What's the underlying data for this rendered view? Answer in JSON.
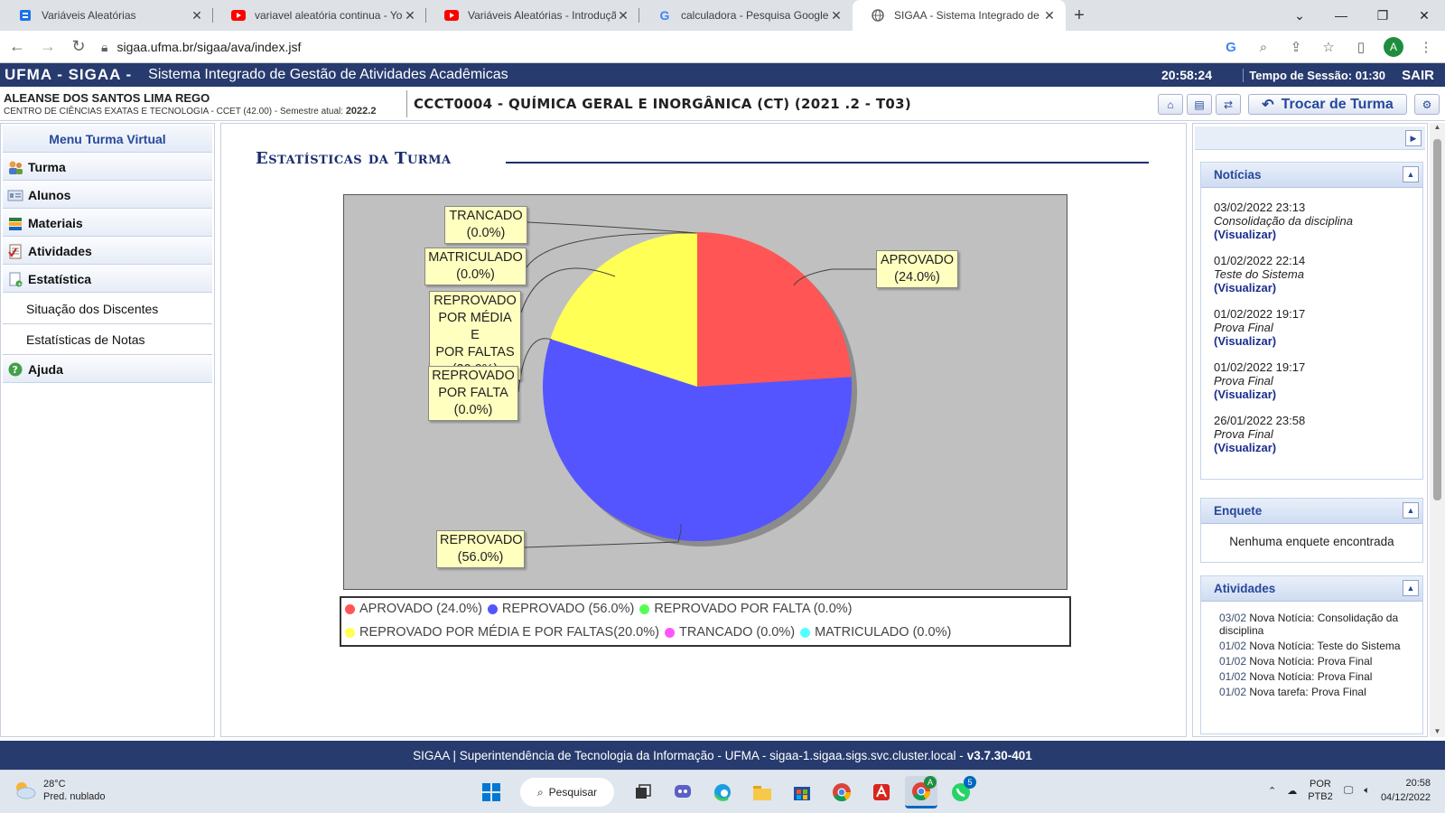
{
  "browser": {
    "tabs": [
      {
        "title": "Variáveis Aleatórias",
        "icon": "docs-icon"
      },
      {
        "title": "variavel aleatória continua - YouT",
        "icon": "youtube-icon"
      },
      {
        "title": "Variáveis Aleatórias - Introdução",
        "icon": "youtube-icon"
      },
      {
        "title": "calculadora - Pesquisa Google",
        "icon": "google-icon"
      },
      {
        "title": "SIGAA - Sistema Integrado de Ge",
        "icon": "globe-icon"
      }
    ],
    "url": "sigaa.ufma.br/sigaa/ava/index.jsf",
    "profile_initial": "A"
  },
  "header": {
    "brand": "UFMA - SIGAA -",
    "system_title": "Sistema Integrado de Gestão de Atividades Acadêmicas",
    "clock": "20:58:24",
    "session": "Tempo de Sessão: 01:30",
    "logout": "SAIR"
  },
  "user": {
    "name": "ALEANSE DOS SANTOS LIMA REGO",
    "center": "CENTRO DE CIÊNCIAS EXATAS E TECNOLOGIA - CCET (42.00) - Semestre atual:",
    "semester": "2022.2",
    "course": "CCCT0004 - QUÍMICA GERAL E INORGÂNICA (CT) (2021 .2 - T03)",
    "change_class": "Trocar de Turma"
  },
  "menu": {
    "title": "Menu Turma Virtual",
    "items": [
      {
        "label": "Turma"
      },
      {
        "label": "Alunos"
      },
      {
        "label": "Materiais"
      },
      {
        "label": "Atividades"
      },
      {
        "label": "Estatística"
      }
    ],
    "subitems": [
      "Situação dos Discentes",
      "Estatísticas de Notas"
    ],
    "help": "Ajuda"
  },
  "main": {
    "title": "Estatísticas da Turma"
  },
  "chart_data": {
    "type": "pie",
    "slices": [
      {
        "label": "APROVADO",
        "value": 24.0,
        "color": "#ff5555"
      },
      {
        "label": "REPROVADO",
        "value": 56.0,
        "color": "#5555ff"
      },
      {
        "label": "REPROVADO POR FALTA",
        "value": 0.0,
        "color": "#55ff55"
      },
      {
        "label": "REPROVADO POR MÉDIA E POR FALTAS",
        "value": 20.0,
        "color": "#ffff55"
      },
      {
        "label": "TRANCADO",
        "value": 0.0,
        "color": "#ff55ff"
      },
      {
        "label": "MATRICULADO",
        "value": 0.0,
        "color": "#55ffff"
      }
    ],
    "callouts": {
      "trancado": [
        "TRANCADO",
        "(0.0%)"
      ],
      "matriculado": [
        "MATRICULADO",
        "(0.0%)"
      ],
      "media_faltas": [
        "REPROVADO",
        "POR MÉDIA E",
        "POR FALTAS",
        "(20.0%)"
      ],
      "falta": [
        "REPROVADO",
        "POR FALTA",
        "(0.0%)"
      ],
      "reprovado": [
        "REPROVADO",
        "(56.0%)"
      ],
      "aprovado": [
        "APROVADO",
        "(24.0%)"
      ]
    },
    "legend": {
      "row1": [
        "APROVADO (24.0%)",
        "REPROVADO (56.0%)",
        "REPROVADO POR FALTA (0.0%)"
      ],
      "row2": [
        "REPROVADO POR MÉDIA E POR FALTAS(20.0%)",
        "TRANCADO (0.0%)",
        "MATRICULADO (0.0%)"
      ]
    }
  },
  "news": {
    "title": "Notícias",
    "items": [
      {
        "date": "03/02/2022 23:13",
        "title": "Consolidação da disciplina",
        "link": "(Visualizar)"
      },
      {
        "date": "01/02/2022 22:14",
        "title": "Teste do Sistema",
        "link": "(Visualizar)"
      },
      {
        "date": "01/02/2022 19:17",
        "title": "Prova Final",
        "link": "(Visualizar)"
      },
      {
        "date": "01/02/2022 19:17",
        "title": "Prova Final",
        "link": "(Visualizar)"
      },
      {
        "date": "26/01/2022 23:58",
        "title": "Prova Final",
        "link": "(Visualizar)"
      }
    ]
  },
  "poll": {
    "title": "Enquete",
    "empty": "Nenhuma enquete encontrada"
  },
  "activities": {
    "title": "Atividades",
    "items": [
      {
        "date": "03/02",
        "text": "Nova Notícia: Consolidação da disciplina"
      },
      {
        "date": "01/02",
        "text": "Nova Notícia: Teste do Sistema"
      },
      {
        "date": "01/02",
        "text": "Nova Notícia: Prova Final"
      },
      {
        "date": "01/02",
        "text": "Nova Notícia: Prova Final"
      },
      {
        "date": "01/02",
        "text": "Nova tarefa: Prova Final"
      }
    ]
  },
  "footer": {
    "text": "SIGAA | Superintendência de Tecnologia da Informação - UFMA - sigaa-1.sigaa.sigs.svc.cluster.local - ",
    "version": "v3.7.30-401"
  },
  "taskbar": {
    "temp": "28°C",
    "weather": "Pred. nublado",
    "search": "Pesquisar",
    "lang1": "POR",
    "lang2": "PTB2",
    "time": "20:58",
    "date": "04/12/2022",
    "whatsapp_badge": "5",
    "chrome_badge": "A"
  }
}
